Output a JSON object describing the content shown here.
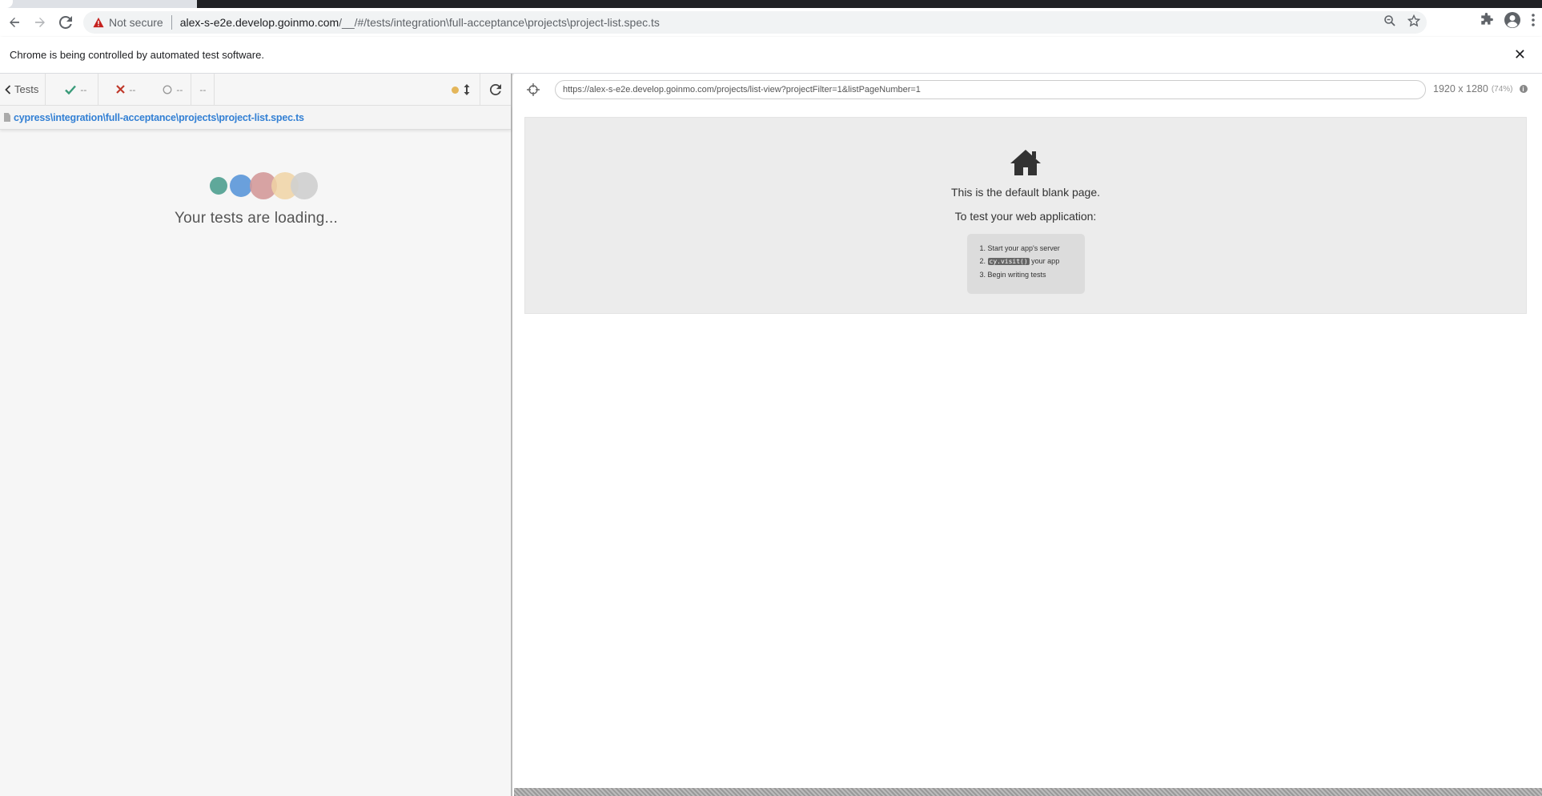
{
  "browser": {
    "security_label": "Not secure",
    "url_host": "alex-s-e2e.develop.goinmo.com",
    "url_path": "/__/#/tests/integration\\full-acceptance\\projects\\project-list.spec.ts",
    "infobar_message": "Chrome is being controlled by automated test software."
  },
  "reporter": {
    "tests_label": "Tests",
    "passed": "--",
    "failed": "--",
    "pending": "--",
    "duration": "--",
    "spec_path": "cypress\\integration\\full-acceptance\\projects\\project-list.spec.ts",
    "loading_text": "Your tests are loading..."
  },
  "aut": {
    "url": "https://alex-s-e2e.develop.goinmo.com/projects/list-view?projectFilter=1&listPageNumber=1",
    "viewport_size": "1920 x 1280",
    "viewport_scale": "(74%)",
    "blank_title": "This is the default blank page.",
    "blank_subtitle": "To test your web application:",
    "steps": {
      "s1": "Start your app's server",
      "s2_code": "cy.visit()",
      "s2_text": " your app",
      "s3": "Begin writing tests"
    }
  },
  "colors": {
    "dot1": "#5fa89a",
    "dot2": "#6aa0dc",
    "dot3": "#d49a9a",
    "dot4": "#f0d4a4",
    "dot5": "#cfcfcf",
    "link": "#3380d4",
    "passed": "#3a9b7a",
    "failed": "#c0392b"
  },
  "icons": {
    "back": "arrow-left-icon",
    "forward": "arrow-right-icon",
    "reload": "reload-icon",
    "warning": "warning-icon",
    "zoom": "zoom-icon",
    "star": "star-icon",
    "extensions": "puzzle-icon",
    "profile": "profile-icon",
    "menu": "kebab-menu-icon",
    "home": "home-icon"
  }
}
